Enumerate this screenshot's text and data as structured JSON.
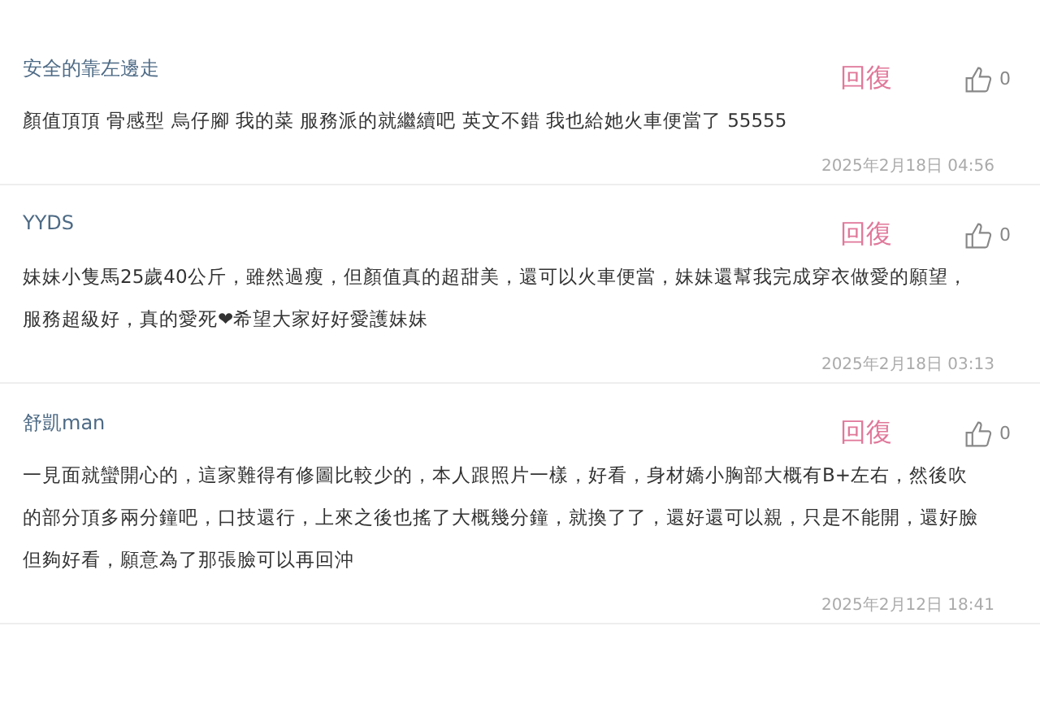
{
  "comments": [
    {
      "author": "安全的靠左邊走",
      "reply": "回復",
      "likes": "0",
      "text": "顏值頂頂 骨感型 烏仔腳 我的菜 服務派的就繼續吧 英文不錯 我也給她火車便當了 55555",
      "time": "2025年2月18日 04:56"
    },
    {
      "author": "YYDS",
      "reply": "回復",
      "likes": "0",
      "text": "妹妹小隻馬25歲40公斤，雖然過瘦，但顏值真的超甜美，還可以火車便當，妹妹還幫我完成穿衣做愛的願望，服務超級好，真的愛死❤希望大家好好愛護妹妹",
      "time": "2025年2月18日 03:13"
    },
    {
      "author": "舒凱man",
      "reply": "回復",
      "likes": "0",
      "text": "一見面就蠻開心的，這家難得有修圖比較少的，本人跟照片一樣，好看，身材嬌小胸部大概有B+左右，然後吹的部分頂多兩分鐘吧，口技還行，上來之後也搖了大概幾分鐘，就換了了，還好還可以親，只是不能開，還好臉但夠好看，願意為了那張臉可以再回沖",
      "time": "2025年2月12日 18:41"
    }
  ]
}
